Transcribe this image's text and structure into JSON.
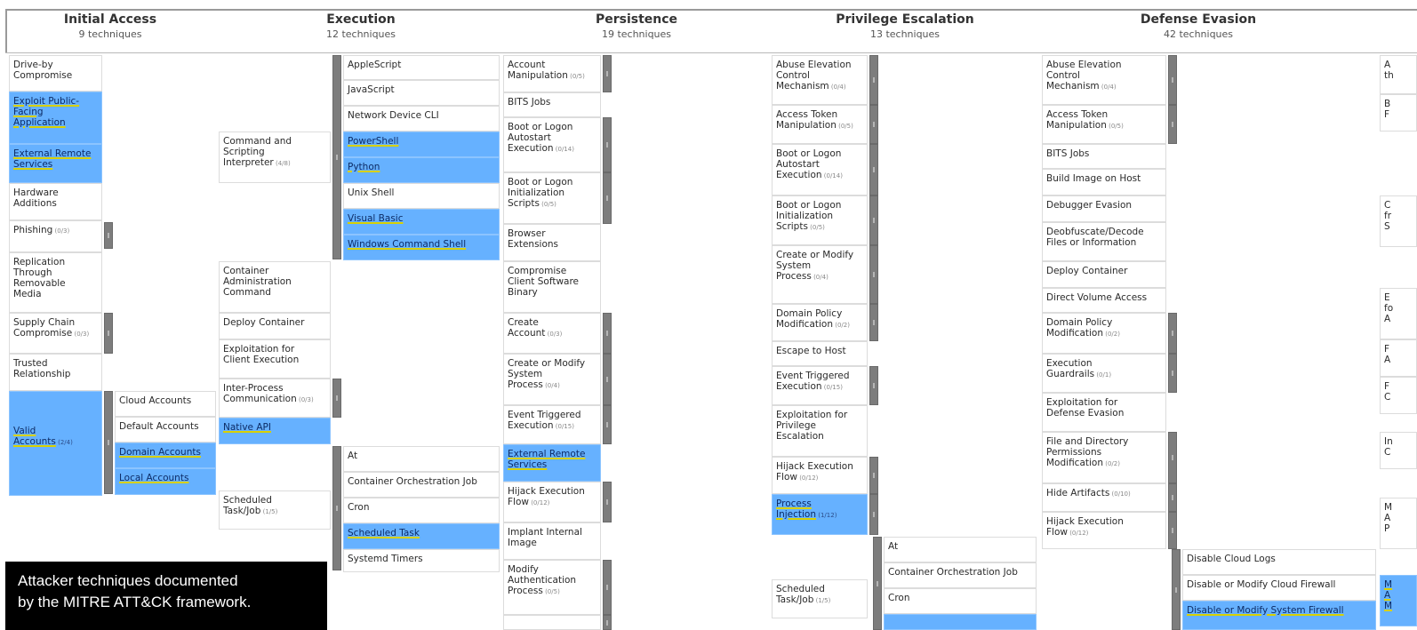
{
  "tactics": [
    {
      "name": "Initial Access",
      "count": "9 techniques"
    },
    {
      "name": "Execution",
      "count": "12 techniques"
    },
    {
      "name": "Persistence",
      "count": "19 techniques"
    },
    {
      "name": "Privilege Escalation",
      "count": "13 techniques"
    },
    {
      "name": "Defense Evasion",
      "count": "42 techniques"
    }
  ],
  "cells": [
    {
      "lines": [
        "Drive-by",
        "Compromise"
      ],
      "hl": false
    },
    {
      "lines": [
        "Exploit Public-",
        "Facing",
        "Application"
      ],
      "hl": true
    },
    {
      "lines": [
        "External Remote",
        "Services"
      ],
      "hl": true
    },
    {
      "lines": [
        "Hardware",
        "Additions"
      ],
      "hl": false
    },
    {
      "lines": [
        "Phishing"
      ],
      "sub": "(0/3)",
      "hl": false
    },
    {
      "lines": [
        "Replication",
        "Through",
        "Removable",
        "Media"
      ],
      "hl": false
    },
    {
      "lines": [
        "Supply Chain",
        "Compromise"
      ],
      "sub": "(0/3)",
      "hl": false
    },
    {
      "lines": [
        "Trusted",
        "Relationship"
      ],
      "hl": false
    },
    {
      "lines": [
        "Valid",
        "Accounts"
      ],
      "sub": "(2/4)",
      "hl": true
    },
    {
      "lines": [
        "Cloud Accounts"
      ],
      "hl": false
    },
    {
      "lines": [
        "Default Accounts"
      ],
      "hl": false
    },
    {
      "lines": [
        "Domain Accounts"
      ],
      "hl": true
    },
    {
      "lines": [
        "Local Accounts"
      ],
      "hl": true
    },
    {
      "lines": [
        "Command and",
        "Scripting",
        "Interpreter"
      ],
      "sub": "(4/8)",
      "hl": false
    },
    {
      "lines": [
        "Container",
        "Administration",
        "Command"
      ],
      "hl": false
    },
    {
      "lines": [
        "Deploy Container"
      ],
      "hl": false
    },
    {
      "lines": [
        "Exploitation for",
        "Client Execution"
      ],
      "hl": false
    },
    {
      "lines": [
        "Inter-Process",
        "Communication"
      ],
      "sub": "(0/3)",
      "hl": false
    },
    {
      "lines": [
        "Native API"
      ],
      "hl": true
    },
    {
      "lines": [
        "Scheduled",
        "Task/Job"
      ],
      "sub": "(1/5)",
      "hl": false
    },
    {
      "lines": [
        "AppleScript"
      ],
      "hl": false
    },
    {
      "lines": [
        "JavaScript"
      ],
      "hl": false
    },
    {
      "lines": [
        "Network Device CLI"
      ],
      "hl": false
    },
    {
      "lines": [
        "PowerShell"
      ],
      "hl": true
    },
    {
      "lines": [
        "Python"
      ],
      "hl": true
    },
    {
      "lines": [
        "Unix Shell"
      ],
      "hl": false
    },
    {
      "lines": [
        "Visual Basic"
      ],
      "hl": true
    },
    {
      "lines": [
        "Windows Command Shell"
      ],
      "hl": true
    },
    {
      "lines": [
        "At"
      ],
      "hl": false
    },
    {
      "lines": [
        "Container Orchestration Job"
      ],
      "hl": false
    },
    {
      "lines": [
        "Cron"
      ],
      "hl": false
    },
    {
      "lines": [
        "Scheduled Task"
      ],
      "hl": true
    },
    {
      "lines": [
        "Systemd Timers"
      ],
      "hl": false
    },
    {
      "lines": [
        "Account",
        "Manipulation"
      ],
      "sub": "(0/5)",
      "hl": false
    },
    {
      "lines": [
        "BITS Jobs"
      ],
      "hl": false
    },
    {
      "lines": [
        "Boot or Logon",
        "Autostart",
        "Execution"
      ],
      "sub": "(0/14)",
      "hl": false
    },
    {
      "lines": [
        "Boot or Logon",
        "Initialization",
        "Scripts"
      ],
      "sub": "(0/5)",
      "hl": false
    },
    {
      "lines": [
        "Browser",
        "Extensions"
      ],
      "hl": false
    },
    {
      "lines": [
        "Compromise",
        "Client Software",
        "Binary"
      ],
      "hl": false
    },
    {
      "lines": [
        "Create",
        "Account"
      ],
      "sub": "(0/3)",
      "hl": false
    },
    {
      "lines": [
        "Create or Modify",
        "System",
        "Process"
      ],
      "sub": "(0/4)",
      "hl": false
    },
    {
      "lines": [
        "Event Triggered",
        "Execution"
      ],
      "sub": "(0/15)",
      "hl": false
    },
    {
      "lines": [
        "External Remote",
        "Services"
      ],
      "hl": true
    },
    {
      "lines": [
        "Hijack Execution",
        "Flow"
      ],
      "sub": "(0/12)",
      "hl": false
    },
    {
      "lines": [
        "Implant Internal",
        "Image"
      ],
      "hl": false
    },
    {
      "lines": [
        "Modify",
        "Authentication",
        "Process"
      ],
      "sub": "(0/5)",
      "hl": false
    },
    {
      "lines": [
        "Abuse Elevation",
        "Control",
        "Mechanism"
      ],
      "sub": "(0/4)",
      "hl": false
    },
    {
      "lines": [
        "Access Token",
        "Manipulation"
      ],
      "sub": "(0/5)",
      "hl": false
    },
    {
      "lines": [
        "Boot or Logon",
        "Autostart",
        "Execution"
      ],
      "sub": "(0/14)",
      "hl": false
    },
    {
      "lines": [
        "Boot or Logon",
        "Initialization",
        "Scripts"
      ],
      "sub": "(0/5)",
      "hl": false
    },
    {
      "lines": [
        "Create or Modify",
        "System",
        "Process"
      ],
      "sub": "(0/4)",
      "hl": false
    },
    {
      "lines": [
        "Domain Policy",
        "Modification"
      ],
      "sub": "(0/2)",
      "hl": false
    },
    {
      "lines": [
        "Escape to Host"
      ],
      "hl": false
    },
    {
      "lines": [
        "Event Triggered",
        "Execution"
      ],
      "sub": "(0/15)",
      "hl": false
    },
    {
      "lines": [
        "Exploitation for",
        "Privilege",
        "Escalation"
      ],
      "hl": false
    },
    {
      "lines": [
        "Hijack Execution",
        "Flow"
      ],
      "sub": "(0/12)",
      "hl": false
    },
    {
      "lines": [
        "Process",
        "Injection"
      ],
      "sub": "(1/12)",
      "hl": true
    },
    {
      "lines": [
        "Scheduled",
        "Task/Job"
      ],
      "sub": "(1/5)",
      "hl": false
    },
    {
      "lines": [
        "At"
      ],
      "hl": false
    },
    {
      "lines": [
        "Container Orchestration Job"
      ],
      "hl": false
    },
    {
      "lines": [
        "Cron"
      ],
      "hl": false
    },
    {
      "lines": [
        ""
      ],
      "hl": true
    },
    {
      "lines": [
        "Abuse Elevation",
        "Control",
        "Mechanism"
      ],
      "sub": "(0/4)",
      "hl": false
    },
    {
      "lines": [
        "Access Token",
        "Manipulation"
      ],
      "sub": "(0/5)",
      "hl": false
    },
    {
      "lines": [
        "BITS Jobs"
      ],
      "hl": false
    },
    {
      "lines": [
        "Build Image on Host"
      ],
      "hl": false
    },
    {
      "lines": [
        "Debugger Evasion"
      ],
      "hl": false
    },
    {
      "lines": [
        "Deobfuscate/Decode",
        "Files or Information"
      ],
      "hl": false
    },
    {
      "lines": [
        "Deploy Container"
      ],
      "hl": false
    },
    {
      "lines": [
        "Direct Volume Access"
      ],
      "hl": false
    },
    {
      "lines": [
        "Domain Policy",
        "Modification"
      ],
      "sub": "(0/2)",
      "hl": false
    },
    {
      "lines": [
        "Execution",
        "Guardrails"
      ],
      "sub": "(0/1)",
      "hl": false
    },
    {
      "lines": [
        "Exploitation for",
        "Defense Evasion"
      ],
      "hl": false
    },
    {
      "lines": [
        "File and Directory",
        "Permissions",
        "Modification"
      ],
      "sub": "(0/2)",
      "hl": false
    },
    {
      "lines": [
        "Hide Artifacts"
      ],
      "sub": "(0/10)",
      "hl": false
    },
    {
      "lines": [
        "Hijack Execution",
        "Flow"
      ],
      "sub": "(0/12)",
      "hl": false
    },
    {
      "lines": [
        "Disable Cloud Logs"
      ],
      "hl": false
    },
    {
      "lines": [
        "Disable or Modify Cloud Firewall"
      ],
      "hl": false
    },
    {
      "lines": [
        "Disable or Modify System Firewall"
      ],
      "hl": true
    },
    {
      "lines": [
        "A",
        "th"
      ],
      "hl": false
    },
    {
      "lines": [
        "B",
        "F"
      ],
      "hl": false
    },
    {
      "lines": [
        "C",
        "fr",
        "S"
      ],
      "hl": false
    },
    {
      "lines": [
        "E",
        "fo",
        "A"
      ],
      "hl": false
    },
    {
      "lines": [
        "F",
        "A"
      ],
      "hl": false
    },
    {
      "lines": [
        "F",
        "C"
      ],
      "hl": false
    },
    {
      "lines": [
        "In",
        "C"
      ],
      "hl": false
    },
    {
      "lines": [
        "M",
        "A",
        "P"
      ],
      "hl": false
    },
    {
      "lines": [
        "M",
        "A",
        "M"
      ],
      "hl": true
    }
  ],
  "caption": {
    "line1": "Attacker techniques documented",
    "line2": "by the MITRE ATT&CK framework."
  }
}
